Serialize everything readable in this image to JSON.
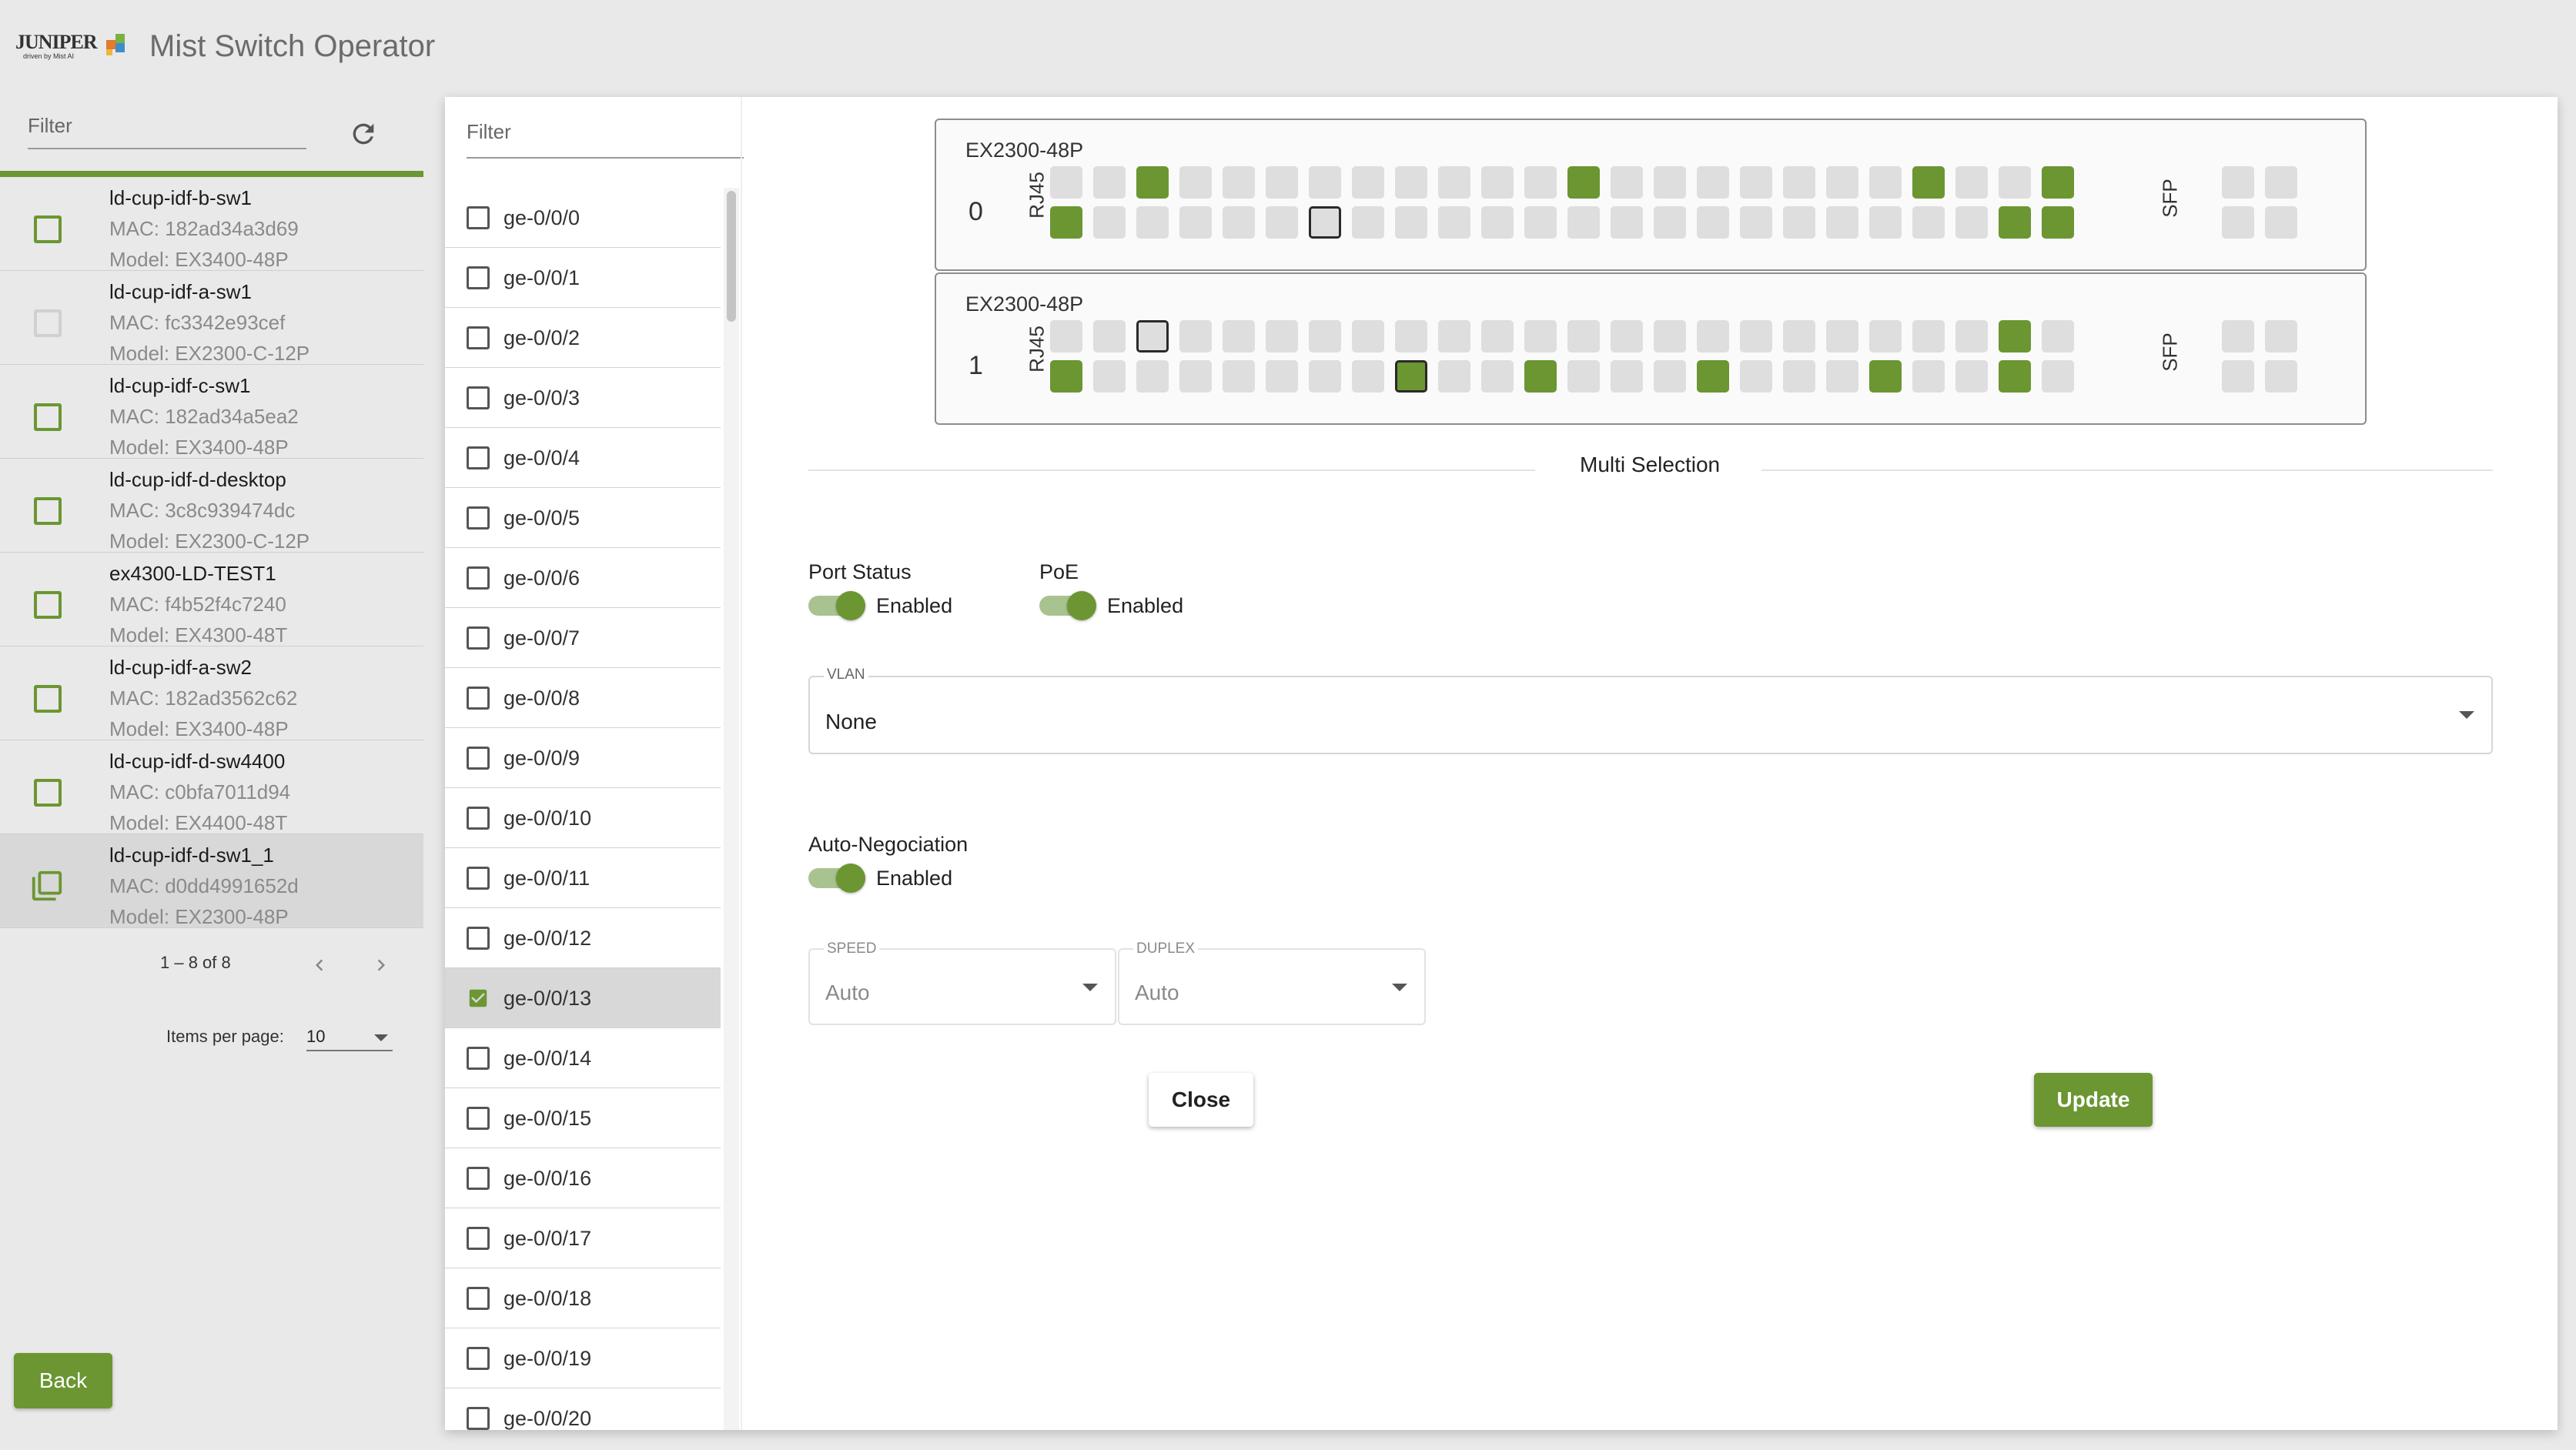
{
  "header": {
    "logo_text": "JUNIPER",
    "logo_subtext": "driven by Mist AI",
    "app_title": "Mist Switch Operator"
  },
  "colors": {
    "accent": "#6b9632",
    "port_idle": "#dedede",
    "panel_bg": "#ffffff",
    "page_bg": "#e9e9e9"
  },
  "devices_panel": {
    "filter_placeholder": "Filter",
    "refresh_icon": "refresh-icon",
    "devices": [
      {
        "name": "ld-cup-idf-b-sw1",
        "mac": "MAC: 182ad34a3d69",
        "model": "Model: EX3400-48P",
        "checkbox": "enabled"
      },
      {
        "name": "ld-cup-idf-a-sw1",
        "mac": "MAC: fc3342e93cef",
        "model": "Model: EX2300-C-12P",
        "checkbox": "disabled"
      },
      {
        "name": "ld-cup-idf-c-sw1",
        "mac": "MAC: 182ad34a5ea2",
        "model": "Model: EX3400-48P",
        "checkbox": "enabled"
      },
      {
        "name": "ld-cup-idf-d-desktop",
        "mac": "MAC: 3c8c939474dc",
        "model": "Model: EX2300-C-12P",
        "checkbox": "enabled"
      },
      {
        "name": "ex4300-LD-TEST1",
        "mac": "MAC: f4b52f4c7240",
        "model": "Model: EX4300-48T",
        "checkbox": "enabled"
      },
      {
        "name": "ld-cup-idf-a-sw2",
        "mac": "MAC: 182ad3562c62",
        "model": "Model: EX3400-48P",
        "checkbox": "enabled"
      },
      {
        "name": "ld-cup-idf-d-sw4400",
        "mac": "MAC: c0bfa7011d94",
        "model": "Model: EX4400-48T",
        "checkbox": "enabled"
      },
      {
        "name": "ld-cup-idf-d-sw1_1",
        "mac": "MAC: d0dd4991652d",
        "model": "Model: EX2300-48P",
        "checkbox": "multi",
        "selected": true
      }
    ],
    "pagination": {
      "range": "1 – 8 of 8",
      "items_per_page_label": "Items per page:",
      "items_per_page": "10"
    },
    "back_label": "Back"
  },
  "ports_panel": {
    "filter_placeholder": "Filter",
    "ports": [
      {
        "label": "ge-0/0/0",
        "checked": false
      },
      {
        "label": "ge-0/0/1",
        "checked": false
      },
      {
        "label": "ge-0/0/2",
        "checked": false
      },
      {
        "label": "ge-0/0/3",
        "checked": false
      },
      {
        "label": "ge-0/0/4",
        "checked": false
      },
      {
        "label": "ge-0/0/5",
        "checked": false
      },
      {
        "label": "ge-0/0/6",
        "checked": false
      },
      {
        "label": "ge-0/0/7",
        "checked": false
      },
      {
        "label": "ge-0/0/8",
        "checked": false
      },
      {
        "label": "ge-0/0/9",
        "checked": false
      },
      {
        "label": "ge-0/0/10",
        "checked": false
      },
      {
        "label": "ge-0/0/11",
        "checked": false
      },
      {
        "label": "ge-0/0/12",
        "checked": false
      },
      {
        "label": "ge-0/0/13",
        "checked": true
      },
      {
        "label": "ge-0/0/14",
        "checked": false
      },
      {
        "label": "ge-0/0/15",
        "checked": false
      },
      {
        "label": "ge-0/0/16",
        "checked": false
      },
      {
        "label": "ge-0/0/17",
        "checked": false
      },
      {
        "label": "ge-0/0/18",
        "checked": false
      },
      {
        "label": "ge-0/0/19",
        "checked": false
      },
      {
        "label": "ge-0/0/20",
        "checked": false
      }
    ]
  },
  "switches": [
    {
      "model": "EX2300-48P",
      "index": "0",
      "rj45_label": "RJ45",
      "sfp_label": "SFP",
      "top_row_up": [
        2,
        12,
        20,
        23
      ],
      "bottom_row_up": [
        0,
        22,
        23
      ],
      "top_row_selected": [],
      "bottom_row_selected": [
        6
      ]
    },
    {
      "model": "EX2300-48P",
      "index": "1",
      "rj45_label": "RJ45",
      "sfp_label": "SFP",
      "top_row_up": [
        22
      ],
      "bottom_row_up": [
        0,
        8,
        11,
        15,
        19,
        22
      ],
      "top_row_selected": [
        2
      ],
      "bottom_row_selected": [
        8
      ]
    }
  ],
  "multi_selection": {
    "title": "Multi Selection",
    "port_status": {
      "label": "Port Status",
      "value": "Enabled",
      "on": true
    },
    "poe": {
      "label": "PoE",
      "value": "Enabled",
      "on": true
    },
    "vlan": {
      "label": "VLAN",
      "value": "None"
    },
    "auto_negotiation": {
      "label": "Auto-Negociation",
      "value": "Enabled",
      "on": true
    },
    "speed": {
      "label": "SPEED",
      "value": "Auto"
    },
    "duplex": {
      "label": "DUPLEX",
      "value": "Auto"
    },
    "close_label": "Close",
    "update_label": "Update"
  }
}
